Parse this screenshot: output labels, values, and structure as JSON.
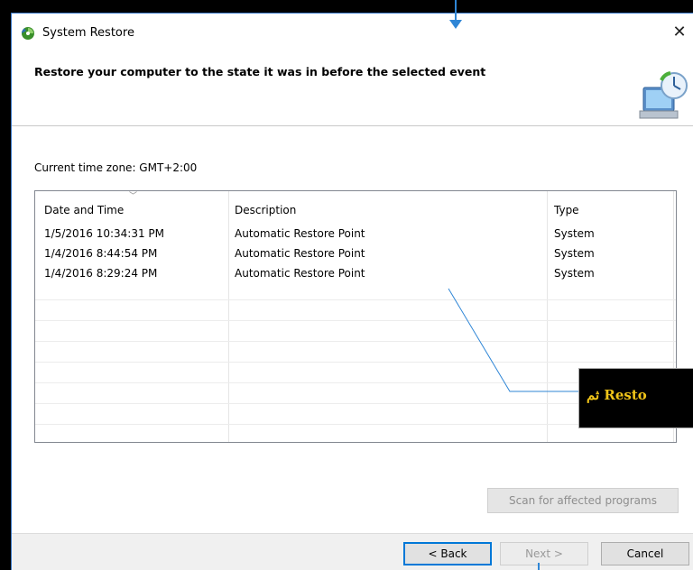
{
  "window": {
    "title": "System Restore",
    "icon": "system-restore-icon",
    "close_glyph": "✕"
  },
  "header": {
    "title": "Restore your computer to the state it was in before the selected event",
    "icon": "restore-computer-icon"
  },
  "timezone": "Current time zone: GMT+2:00",
  "table": {
    "columns": [
      "Date and Time",
      "Description",
      "Type"
    ],
    "sort_glyph": "﹀",
    "rows": [
      {
        "date": "1/5/2016 10:34:31 PM",
        "description": "Automatic Restore Point",
        "type": "System"
      },
      {
        "date": "1/4/2016 8:44:54 PM",
        "description": "Automatic Restore Point",
        "type": "System"
      },
      {
        "date": "1/4/2016 8:29:24 PM",
        "description": "Automatic Restore Point",
        "type": "System"
      }
    ]
  },
  "buttons": {
    "scan": "Scan for affected programs",
    "back": "< Back",
    "next": "Next >",
    "cancel": "Cancel"
  },
  "annotation": {
    "callout_text": "ثم Resto",
    "color": "#2f86d6",
    "text_color": "#f0c419"
  }
}
